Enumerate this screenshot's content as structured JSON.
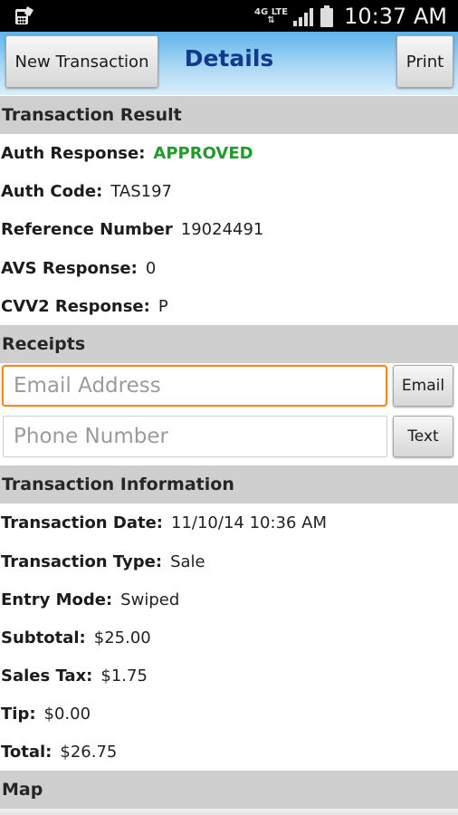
{
  "status_bar": {
    "network": "4G LTE",
    "time": "10:37 AM"
  },
  "header": {
    "new_transaction_label": "New Transaction",
    "title": "Details",
    "print_label": "Print"
  },
  "transaction_result": {
    "heading": "Transaction Result",
    "rows": [
      {
        "label": "Auth Response:",
        "value": "APPROVED"
      },
      {
        "label": "Auth Code:",
        "value": "TAS197"
      },
      {
        "label": "Reference Number",
        "value": "19024491"
      },
      {
        "label": "AVS Response:",
        "value": "0"
      },
      {
        "label": "CVV2 Response:",
        "value": "P"
      }
    ]
  },
  "receipts": {
    "heading": "Receipts",
    "email_placeholder": "Email Address",
    "email_button": "Email",
    "phone_placeholder": "Phone Number",
    "text_button": "Text"
  },
  "transaction_information": {
    "heading": "Transaction Information",
    "rows": [
      {
        "label": "Transaction Date:",
        "value": "11/10/14 10:36 AM"
      },
      {
        "label": "Transaction Type:",
        "value": "Sale"
      },
      {
        "label": "Entry Mode:",
        "value": "Swiped"
      },
      {
        "label": "Subtotal:",
        "value": "$25.00"
      },
      {
        "label": "Sales Tax:",
        "value": "$1.75"
      },
      {
        "label": "Tip:",
        "value": "$0.00"
      },
      {
        "label": "Total:",
        "value": "$26.75"
      }
    ]
  },
  "map": {
    "heading": "Map"
  },
  "colors": {
    "approved": "#239a2e",
    "title": "#113a8a",
    "focus": "#f08a1c",
    "section_bg": "#cfcfcf"
  },
  "icons": [
    "app-notification-icon",
    "signal-icon",
    "battery-icon"
  ]
}
